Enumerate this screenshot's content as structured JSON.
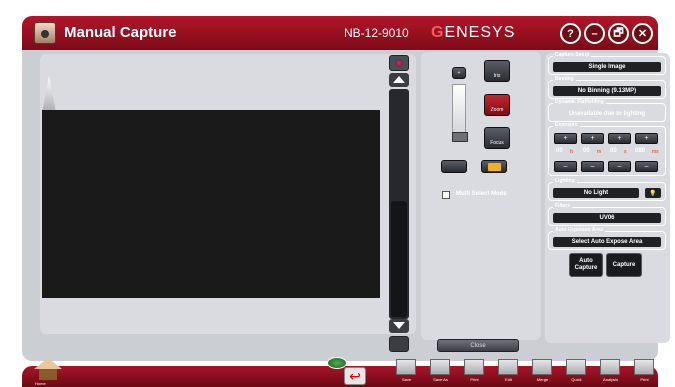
{
  "window": {
    "title": "Manual Capture",
    "serial": "NB-12-9010",
    "brand": "GENESYS",
    "buttons": {
      "help": "?",
      "minimize": "–",
      "restore": "🗗",
      "close": "✕"
    }
  },
  "camera_controls": {
    "iris_label": "Iris",
    "zoom_label": "Zoom",
    "focus_label": "Focus",
    "multi_select_label": "Multi Select Mode",
    "close_label": "Close"
  },
  "right_panel": {
    "capture_setup": {
      "label": "Capture Setup",
      "value": "Single Image"
    },
    "binning": {
      "label": "Binning",
      "value": "No Binning (9.13MP)"
    },
    "dynamic_flatfielding": {
      "label": "Dynamic Flatfielding",
      "value": "Unavailable due to lighting"
    },
    "exposure": {
      "label": "Exposure",
      "up_buttons": [
        "+",
        "+",
        "+",
        "+"
      ],
      "digits": [
        "00",
        "00",
        "00",
        "080"
      ],
      "units": [
        "h",
        "m",
        "s",
        "ms"
      ],
      "down_buttons": [
        "–",
        "–",
        "–",
        "–"
      ]
    },
    "lighting": {
      "label": "Lighting",
      "value": "No Light"
    },
    "filters": {
      "label": "Filters",
      "value": "UV06"
    },
    "auto_exposure_area": {
      "label": "Auto Exposure Area",
      "value": "Select Auto Expose Area"
    },
    "auto_capture_label": "Auto Capture",
    "capture_label": "Capture"
  },
  "bottom_bar": {
    "home_label": "Home",
    "tools": [
      "Save",
      "Save As",
      "Print",
      "Edit",
      "Merge",
      "Quick",
      "Analysis",
      "Print"
    ]
  }
}
